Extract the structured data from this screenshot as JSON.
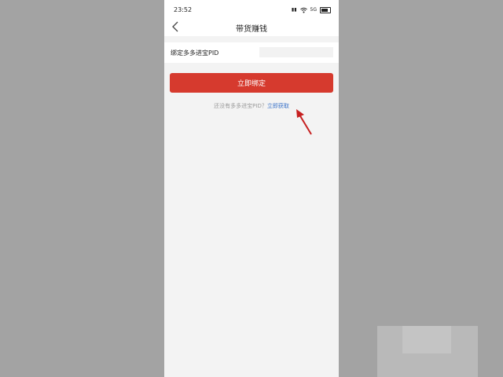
{
  "status_bar": {
    "time": "23:52",
    "icons": [
      "signal-icon",
      "wifi-icon",
      "data-icon",
      "battery-icon"
    ],
    "signal_text": "5G"
  },
  "navbar": {
    "title": "带货赚钱"
  },
  "form": {
    "label": "绑定多多进宝PID",
    "value": ""
  },
  "button": {
    "label": "立即绑定"
  },
  "hint": {
    "text": "还没有多多进宝PID？",
    "link": "立即获取"
  },
  "colors": {
    "primary": "#d63a2e",
    "link": "#3b73c9",
    "annotation": "#c62020"
  }
}
